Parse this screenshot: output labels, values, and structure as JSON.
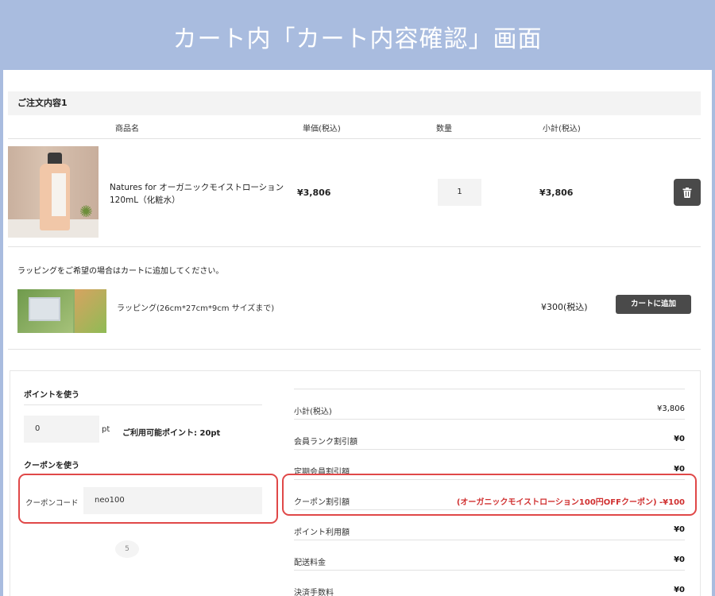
{
  "banner": {
    "title": "カート内「カート内容確認」画面"
  },
  "order": {
    "header": "ご注文内容1",
    "columns": {
      "product": "商品名",
      "unit_price": "単価(税込)",
      "quantity": "数量",
      "subtotal": "小計(税込)"
    },
    "item": {
      "name_line1": "Natures for オーガニックモイストローション",
      "name_line2": "120mL（化粧水）",
      "unit_price": "¥3,806",
      "quantity": "1",
      "subtotal": "¥3,806"
    }
  },
  "wrapping": {
    "message": "ラッピングをご希望の場合はカートに追加してください。",
    "label": "ラッピング(26cm*27cm*9cm サイズまで)",
    "price": "¥300(税込)",
    "add_button": "カートに追加"
  },
  "points": {
    "title": "ポイントを使う",
    "value": "0",
    "unit": "pt",
    "available": "ご利用可能ポイント: 20pt"
  },
  "coupon": {
    "title": "クーポンを使う",
    "code_label": "クーポンコード",
    "code_value": "neo100",
    "count": "5"
  },
  "summary": {
    "rows": [
      {
        "label": "小計(税込)",
        "value": "¥3,806"
      },
      {
        "label": "会員ランク割引額",
        "value": "¥0"
      },
      {
        "label": "定期会員割引額",
        "value": "¥0"
      },
      {
        "label": "クーポン割引額",
        "value": "(オーガニックモイストローション100円OFFクーポン) -¥100"
      },
      {
        "label": "ポイント利用額",
        "value": "¥0"
      },
      {
        "label": "配送料金",
        "value": "¥0"
      },
      {
        "label": "決済手数料",
        "value": "¥0"
      }
    ]
  },
  "colors": {
    "banner_bg": "#a9bcdf",
    "highlight": "#e04848",
    "button_dark": "#4a4a4a",
    "discount_red": "#d03030"
  }
}
